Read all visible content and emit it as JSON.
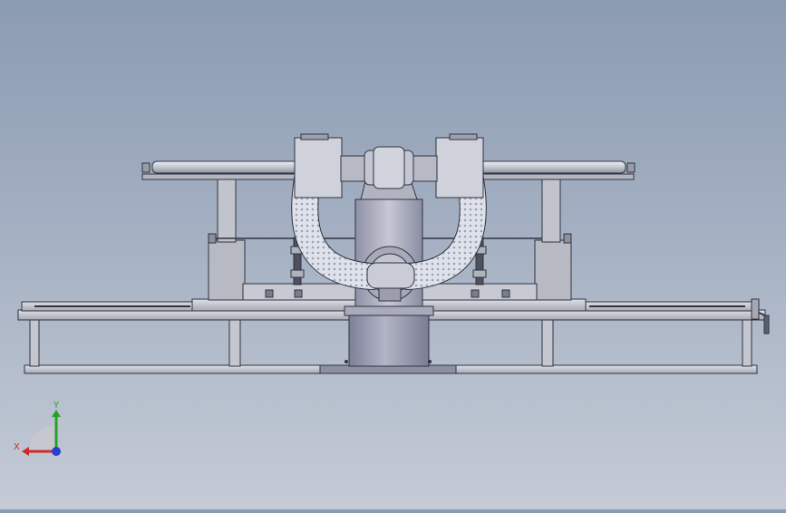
{
  "app": {
    "view": "Front",
    "background_top": "#8b9bb2",
    "background_bottom": "#c4cbd6"
  },
  "model": {
    "components": [
      "base-frame",
      "left-linear-rail",
      "right-linear-rail",
      "robot-pedestal",
      "robot-body",
      "u-shaped-flexible-hose",
      "left-gun-head",
      "right-gun-head",
      "top-guide-bar",
      "left-support-column",
      "right-support-column",
      "left-cylinder",
      "right-cylinder",
      "handwheel"
    ],
    "colors": {
      "steel": "#b9bcc4",
      "steel_dark": "#6f7380",
      "pedestal": "#9497ad",
      "hose": "#d9dce4",
      "outline": "#2f3340"
    }
  },
  "triad": {
    "x_label": "X",
    "y_label": "Y",
    "x_color": "#d12a2a",
    "y_color": "#2aa02a",
    "z_color": "#2a3fd1"
  }
}
